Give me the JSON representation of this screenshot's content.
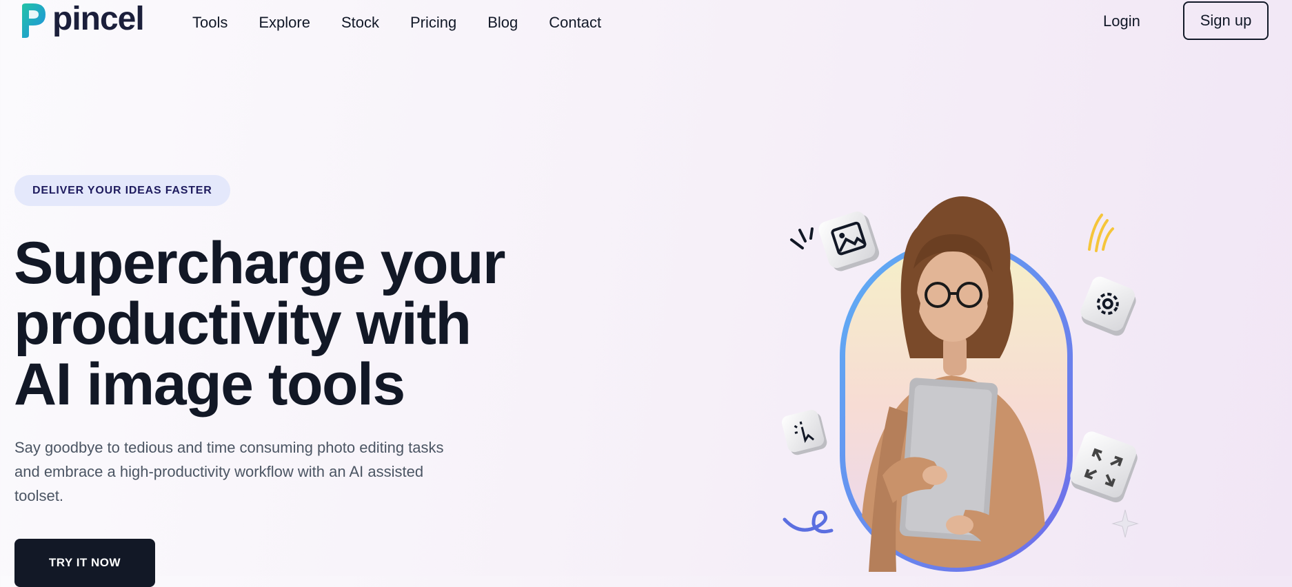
{
  "brand": {
    "name": "pincel",
    "logo_colors": [
      "#22c3a6",
      "#1f8fe0"
    ]
  },
  "nav": {
    "items": [
      {
        "label": "Tools"
      },
      {
        "label": "Explore"
      },
      {
        "label": "Stock"
      },
      {
        "label": "Pricing"
      },
      {
        "label": "Blog"
      },
      {
        "label": "Contact"
      }
    ],
    "login_label": "Login",
    "signup_label": "Sign up"
  },
  "hero": {
    "badge": "DELIVER YOUR IDEAS FASTER",
    "title_lines": [
      "Supercharge your",
      "productivity with",
      "AI image tools"
    ],
    "subtitle_lines": [
      "Say goodbye to tedious and time consuming photo editing tasks",
      "and embrace a high-productivity workflow with an AI assisted",
      "toolset."
    ],
    "cta_label": "TRY IT NOW"
  },
  "illustration": {
    "icons": [
      "image-icon",
      "gear-icon",
      "sparkle-cursor-icon",
      "expand-icon",
      "sparkle-star-icon",
      "squiggle-icon"
    ],
    "colors": {
      "frame_blue": "#5fb0f5",
      "frame_purple": "#6f6ae8",
      "jacket": "#c9926a",
      "shirt": "#f3cf7a",
      "laptop": "#b9b9bd",
      "dark_ink": "#121826"
    }
  },
  "theme": {
    "text_dark": "#121826",
    "badge_bg": "#e4e8fb",
    "badge_text": "#1e1b5e",
    "body_text": "#4b5563"
  }
}
